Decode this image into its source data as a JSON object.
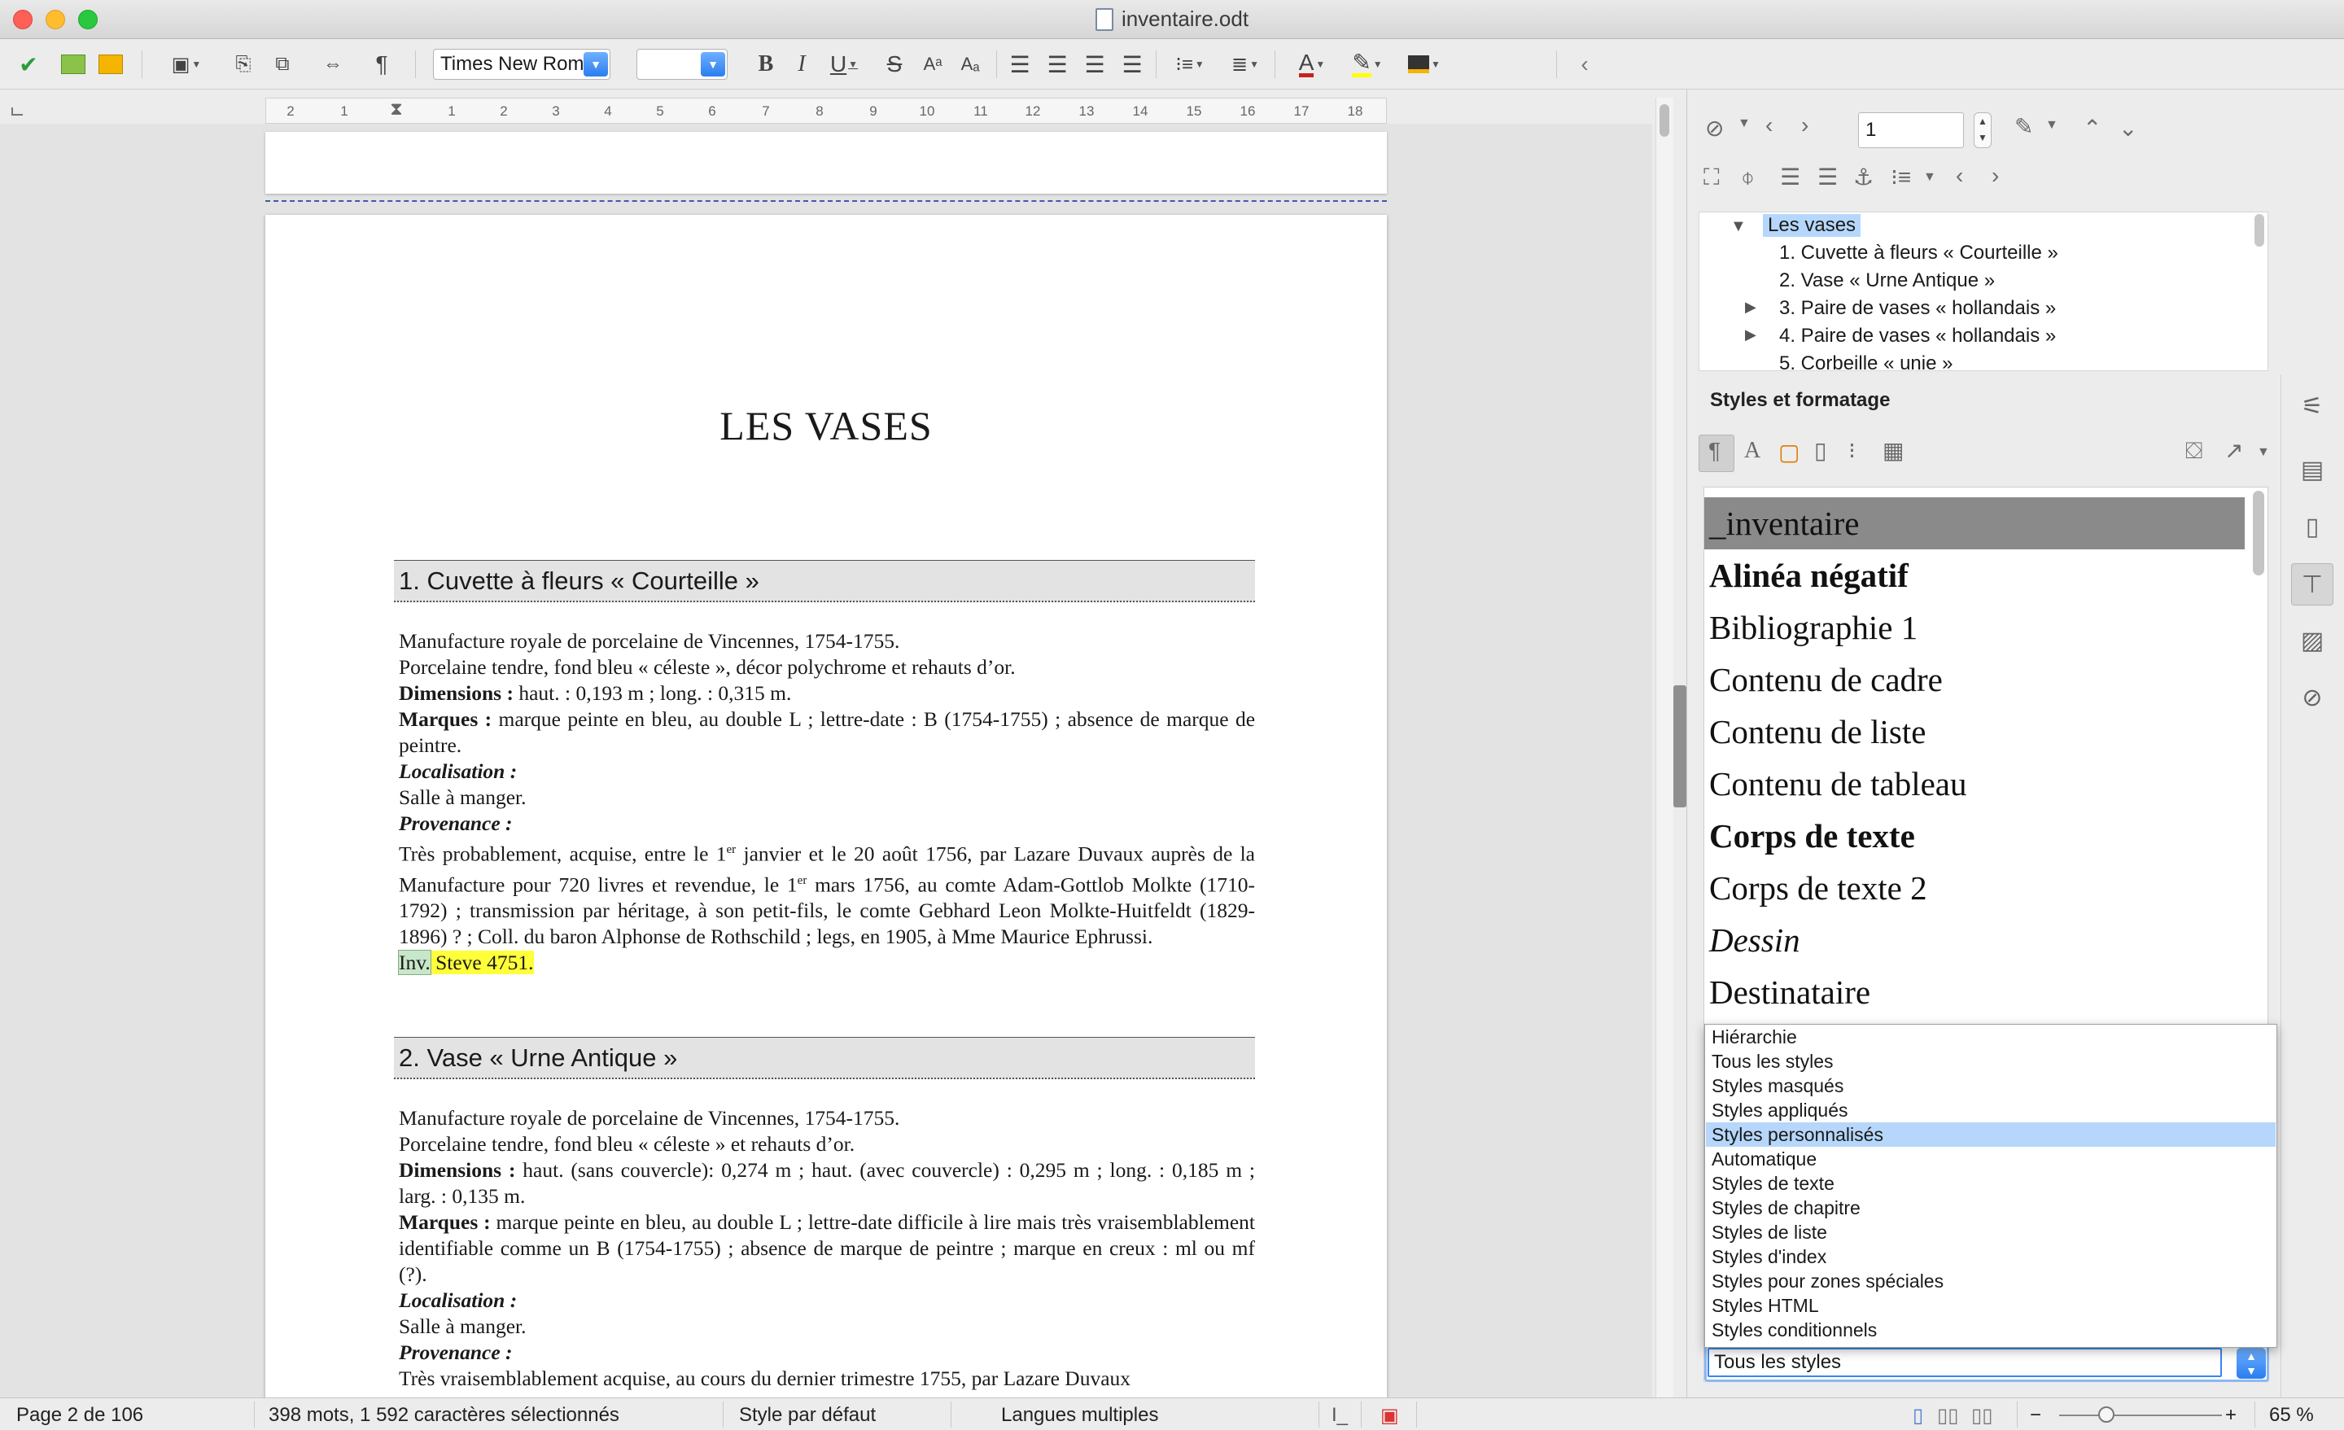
{
  "window": {
    "title": "inventaire.odt"
  },
  "toolbar": {
    "font_name": "Times New Roman",
    "font_size": "",
    "icons": [
      "check-icon",
      "edit-icon",
      "layout-icon",
      "save-icon",
      "undo-icon",
      "redo-icon",
      "link-icon",
      "paragraph-mark-icon",
      "bold-icon",
      "italic-icon",
      "underline-icon",
      "strikethrough-icon",
      "superscript-icon",
      "subscript-icon",
      "align-left-icon",
      "align-center-icon",
      "align-right-icon",
      "justify-icon",
      "list-icon",
      "outline-icon",
      "font-color-icon",
      "highlight-icon",
      "background-color-icon",
      "back-arrow-icon"
    ],
    "glyphs": {
      "bold": "B",
      "italic": "I",
      "underline": "U",
      "strike": "S",
      "paragraph": "¶",
      "superscript": "Aᵃ",
      "subscript": "Aₐ",
      "back": "‹",
      "font_color": "A"
    }
  },
  "ruler": {
    "labels": [
      "2",
      "1",
      "1",
      "2",
      "3",
      "4",
      "5",
      "6",
      "7",
      "8",
      "9",
      "10",
      "11",
      "12",
      "13",
      "14",
      "15",
      "16",
      "17",
      "18"
    ]
  },
  "document": {
    "page_title": "LES VASES",
    "sections": [
      {
        "heading": "1. Cuvette à fleurs « Courteille »",
        "lines": {
          "l1": "Manufacture royale de porcelaine de Vincennes, 1754-1755.",
          "l2": "Porcelaine tendre, fond bleu « céleste », décor polychrome et rehauts d’or.",
          "dim_label": "Dimensions :",
          "dim_text": " haut. : 0,193 m ; long. : 0,315 m.",
          "marques_label": "Marques :",
          "marques_text": " marque peinte en bleu, au double L ; lettre-date : B (1754-1755) ; absence de marque de peintre.",
          "loc_label": "Localisation :",
          "loc_text": "Salle à manger.",
          "prov_label": "Provenance :",
          "prov_text_a": "Très probablement, acquise, entre le 1",
          "prov_sup1": "er",
          "prov_text_b": " janvier et le 20 août 1756, par Lazare Duvaux auprès de la Manufacture pour 720 livres et revendue, le 1",
          "prov_sup2": "er",
          "prov_text_c": " mars 1756, au comte Adam-Gottlob Molkte (1710-1792) ; transmission par héritage, à son petit-fils, le comte Gebhard Leon Molkte-Huitfeldt (1829-1896) ? ; Coll. du baron Alphonse de Rothschild ; legs, en 1905, à Mme Maurice Ephrussi.",
          "inv_a": "Inv.",
          "inv_b": " Steve 4751."
        }
      },
      {
        "heading": "2. Vase « Urne Antique »",
        "lines": {
          "l1": "Manufacture royale de porcelaine de Vincennes, 1754-1755.",
          "l2": "Porcelaine tendre, fond bleu « céleste » et rehauts d’or.",
          "dim_label": "Dimensions :",
          "dim_text": " haut. (sans couvercle): 0,274 m ; haut. (avec couvercle) : 0,295 m ; long. : 0,185 m ; larg. : 0,135 m.",
          "marques_label": "Marques :",
          "marques_text": " marque peinte en bleu, au double L ; lettre-date difficile à lire mais très vraisemblablement identifiable comme un B (1754-1755) ; absence de marque de peintre ; marque en creux : ml ou mf (?).",
          "loc_label": "Localisation :",
          "loc_text": "Salle à manger.",
          "prov_label": "Provenance :",
          "prov_text_a": "Très vraisemblablement acquise, au cours du dernier trimestre 1755, par Lazare Duvaux"
        }
      }
    ]
  },
  "navigator": {
    "page_number": "1",
    "tree": {
      "root": "Les vases",
      "items": [
        "1. Cuvette à fleurs « Courteille »",
        "2. Vase « Urne Antique »",
        "3. Paire de vases « hollandais »",
        "4. Paire de vases « hollandais »",
        "5. Corbeille « unie »"
      ]
    }
  },
  "styles": {
    "title": "Styles et formatage",
    "items": [
      "_inventaire",
      "Alinéa négatif",
      "Bibliographie 1",
      "Contenu de cadre",
      "Contenu de liste",
      "Contenu de tableau",
      "Corps de texte",
      "Corps de texte 2",
      "Dessin",
      "Destinataire"
    ],
    "filter_options": [
      "Hiérarchie",
      "Tous les styles",
      "Styles masqués",
      "Styles appliqués",
      "Styles personnalisés",
      "Automatique",
      "Styles de texte",
      "Styles de chapitre",
      "Styles de liste",
      "Styles d'index",
      "Styles pour zones spéciales",
      "Styles HTML",
      "Styles conditionnels"
    ],
    "filter_value": "Tous les styles"
  },
  "statusbar": {
    "page": "Page 2 de 106",
    "words": "398 mots, 1 592 caractères sélectionnés",
    "style": "Style par défaut",
    "language": "Langues multiples",
    "zoom": "65 %",
    "zoom_minus": "−",
    "zoom_plus": "+"
  }
}
